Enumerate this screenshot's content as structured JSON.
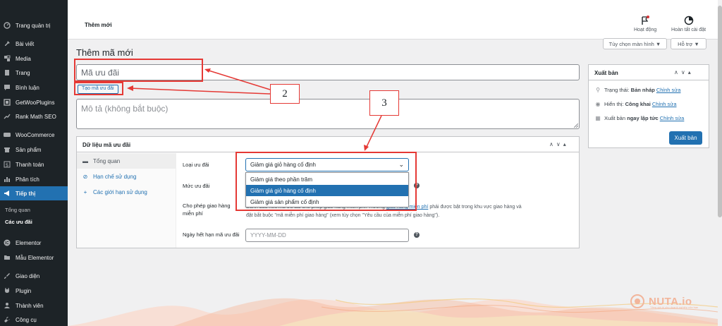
{
  "sidebar": {
    "items": [
      {
        "label": "Trang quản trị",
        "icon": "dashboard-icon"
      },
      {
        "label": "Bài viết",
        "icon": "pin-icon"
      },
      {
        "label": "Media",
        "icon": "media-icon"
      },
      {
        "label": "Trang",
        "icon": "page-icon"
      },
      {
        "label": "Bình luận",
        "icon": "comment-icon"
      },
      {
        "label": "GetWooPlugins",
        "icon": "plugin-box-icon"
      },
      {
        "label": "Rank Math SEO",
        "icon": "chart-line-icon"
      },
      {
        "label": "WooCommerce",
        "icon": "woo-icon"
      },
      {
        "label": "Sản phẩm",
        "icon": "archive-icon"
      },
      {
        "label": "Thanh toán",
        "icon": "dollar-icon"
      },
      {
        "label": "Phân tích",
        "icon": "bar-chart-icon"
      },
      {
        "label": "Tiếp thị",
        "icon": "megaphone-icon"
      },
      {
        "label": "Elementor",
        "icon": "elementor-icon"
      },
      {
        "label": "Mẫu Elementor",
        "icon": "folder-icon"
      },
      {
        "label": "Giao diện",
        "icon": "brush-icon"
      },
      {
        "label": "Plugin",
        "icon": "plug-icon"
      },
      {
        "label": "Thành viên",
        "icon": "user-icon"
      },
      {
        "label": "Công cụ",
        "icon": "wrench-icon"
      }
    ],
    "submenu": [
      "Tổng quan",
      "Các ưu đãi"
    ]
  },
  "topbar": {
    "page_title": "Thêm mới",
    "activity_label": "Hoạt động",
    "setup_label": "Hoàn tất cài đặt"
  },
  "screen_options": "Tùy chọn màn hình ▼",
  "help_button": "Hỗ trợ ▼",
  "heading": "Thêm mã mới",
  "coupon_code_placeholder": "Mã ưu đãi",
  "generate_code_label": "Tạo mã ưu đãi",
  "description_placeholder": "Mô tả (không bắt buộc)",
  "coupon_data": {
    "title": "Dữ liệu mã ưu đãi",
    "tabs": [
      {
        "label": "Tổng quan",
        "icon": "settings-icon"
      },
      {
        "label": "Hạn chế sử dụng",
        "icon": "ban-icon"
      },
      {
        "label": "Các giới hạn sử dụng",
        "icon": "plus-icon"
      }
    ],
    "discount_type_label": "Loại ưu đãi",
    "discount_type_value": "Giảm giá giỏ hàng cố định",
    "discount_options": [
      "Giảm giá theo phần trăm",
      "Giảm giá giỏ hàng cố định",
      "Giảm giá sản phẩm cố định"
    ],
    "amount_label": "Mức ưu đãi",
    "free_shipping_label_1": "Cho phép giao hàng",
    "free_shipping_label_2": "miễn phí",
    "free_shipping_text_1": "Đánh dấu nếu mã ưu đãi cho phép giao hàng miễn phí. Trường",
    "free_shipping_link": "giao hàng miễn phí",
    "free_shipping_text_2": "phải được bật trong khu vực giao hàng và",
    "free_shipping_text_3": "đặt bắt buộc \"mã miễn phí giao hàng\" (xem tùy chọn \"Yêu cầu của miễn phí giao hàng\").",
    "expiry_label": "Ngày hết hạn mã ưu đãi",
    "expiry_placeholder": "YYYY-MM-DD"
  },
  "publish": {
    "title": "Xuất bản",
    "status_label": "Trạng thái:",
    "status_value": "Bản nháp",
    "visibility_label": "Hiển thị:",
    "visibility_value": "Công khai",
    "schedule_label": "Xuất bản",
    "schedule_value": "ngay lập tức",
    "edit_link": "Chỉnh sửa",
    "button": "Xuất bản"
  },
  "annotations": {
    "callout_2": "2",
    "callout_3": "3"
  },
  "colors": {
    "accent": "#2271b1",
    "sidebar_bg": "#1d2327",
    "annotation": "#e53935"
  },
  "logo": {
    "text": "NUTA.io",
    "tagline": "Tăng giá trị cho doanh nghiệp của bạn"
  }
}
